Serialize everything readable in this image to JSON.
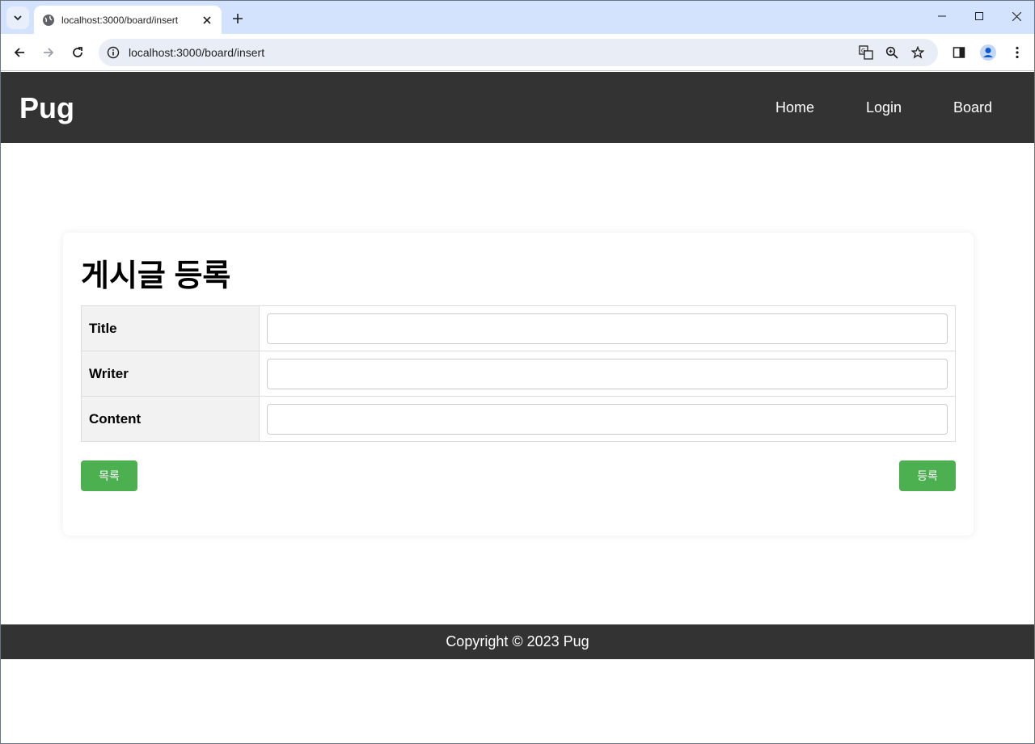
{
  "browser": {
    "tab_title": "localhost:3000/board/insert",
    "url": "localhost:3000/board/insert"
  },
  "header": {
    "logo": "Pug",
    "nav": [
      {
        "label": "Home"
      },
      {
        "label": "Login"
      },
      {
        "label": "Board"
      }
    ]
  },
  "form": {
    "heading": "게시글 등록",
    "fields": [
      {
        "label": "Title",
        "value": ""
      },
      {
        "label": "Writer",
        "value": ""
      },
      {
        "label": "Content",
        "value": ""
      }
    ],
    "list_button": "목록",
    "submit_button": "등록"
  },
  "footer": {
    "text": "Copyright © 2023 Pug"
  },
  "colors": {
    "header_bg": "#333333",
    "button_green": "#4caf50",
    "tabstrip_bg": "#d3e3fd"
  }
}
